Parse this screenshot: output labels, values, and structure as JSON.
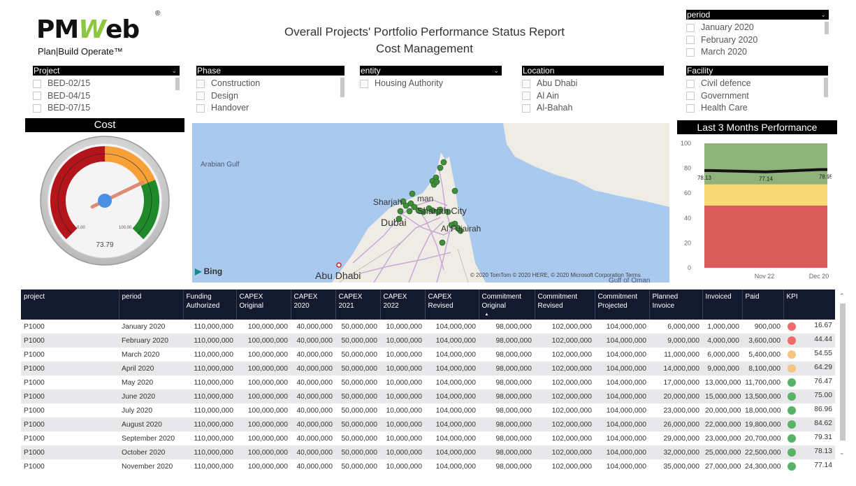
{
  "logo": {
    "main": "PMWeb",
    "p1": "PM",
    "w": "W",
    "rest": "eb",
    "reg": "®",
    "tagline": "Plan|Build Operate™"
  },
  "title": {
    "line1": "Overall Projects' Portfolio Performance Status Report",
    "line2": "Cost Management"
  },
  "slicers": {
    "period": {
      "label": "period",
      "items": [
        "January 2020",
        "February 2020",
        "March 2020"
      ]
    },
    "project": {
      "label": "Project",
      "items": [
        "BED-02/15",
        "BED-04/15",
        "BED-07/15"
      ]
    },
    "phase": {
      "label": "Phase",
      "items": [
        "Construction",
        "Design",
        "Handover"
      ]
    },
    "entity": {
      "label": "entity",
      "items": [
        "Housing Authority"
      ]
    },
    "location": {
      "label": "Location",
      "items": [
        "Abu Dhabi",
        "Al Ain",
        "Al-Bahah"
      ]
    },
    "facility": {
      "label": "Facility",
      "items": [
        "Civil defence",
        "Government",
        "Health Care"
      ]
    }
  },
  "cost": {
    "title": "Cost",
    "value": "73.79",
    "min_label": "0.00",
    "max_label": "100.00",
    "value_num": 73.79
  },
  "map": {
    "labels": {
      "gulf": "Arabian Gulf",
      "sharjah": "Sharjah",
      "ajman": "man",
      "dubai": "Dubai",
      "sharjahcity": "Sharjah City",
      "fujairah": "Al Fujairah",
      "abudhabi": "Abu Dhabi",
      "gulfoman": "Gulf of Oman"
    },
    "bing": "Bing",
    "copyright": "© 2020 TomTom © 2020 HERE, © 2020 Microsoft Corporation  Terms"
  },
  "perf": {
    "title": "Last 3 Months Performance",
    "y_ticks": [
      "100",
      "80",
      "60",
      "40",
      "20",
      "0"
    ],
    "x_ticks": [
      "Nov 22",
      "Dec 20"
    ],
    "point_labels": [
      "78.13",
      "77.14",
      "78.95"
    ]
  },
  "chart_data": {
    "type": "line",
    "title": "Last 3 Months Performance",
    "x": [
      "",
      "Nov 22",
      "Dec 20"
    ],
    "series": [
      {
        "values": [
          78.13,
          77.14,
          78.95
        ]
      }
    ],
    "bands": [
      {
        "from": 0,
        "to": 50,
        "color": "#d95b5b"
      },
      {
        "from": 50,
        "to": 67,
        "color": "#f8d872"
      },
      {
        "from": 67,
        "to": 100,
        "color": "#8fb27b"
      }
    ],
    "ylim": [
      0,
      100
    ],
    "xlabel": "",
    "ylabel": ""
  },
  "colors": {
    "red": "#ee6c6c",
    "orange": "#f5c483",
    "green": "#5ab267"
  },
  "table": {
    "headers": [
      "project",
      "period",
      "Funding Authorized",
      "CAPEX Original",
      "CAPEX 2020",
      "CAPEX 2021",
      "CAPEX 2022",
      "CAPEX Revised",
      "Commitment Original",
      "Commitment Revised",
      "Commitment Projected",
      "Planned Invoice",
      "Invoiced",
      "Paid",
      "KPI"
    ],
    "rows": [
      {
        "project": "P1000",
        "period": "January 2020",
        "funding": "110,000,000",
        "capex_orig": "100,000,000",
        "c2020": "40,000,000",
        "c2021": "50,000,000",
        "c2022": "10,000,000",
        "capex_rev": "104,000,000",
        "com_orig": "98,000,000",
        "com_rev": "102,000,000",
        "com_proj": "104,000,000",
        "planned": "6,000,000",
        "invoiced": "1,000,000",
        "paid": "900,000",
        "kpi_color": "red",
        "kpi": "16.67"
      },
      {
        "project": "P1000",
        "period": "February 2020",
        "funding": "110,000,000",
        "capex_orig": "100,000,000",
        "c2020": "40,000,000",
        "c2021": "50,000,000",
        "c2022": "10,000,000",
        "capex_rev": "104,000,000",
        "com_orig": "98,000,000",
        "com_rev": "102,000,000",
        "com_proj": "104,000,000",
        "planned": "9,000,000",
        "invoiced": "4,000,000",
        "paid": "3,600,000",
        "kpi_color": "red",
        "kpi": "44.44"
      },
      {
        "project": "P1000",
        "period": "March 2020",
        "funding": "110,000,000",
        "capex_orig": "100,000,000",
        "c2020": "40,000,000",
        "c2021": "50,000,000",
        "c2022": "10,000,000",
        "capex_rev": "104,000,000",
        "com_orig": "98,000,000",
        "com_rev": "102,000,000",
        "com_proj": "104,000,000",
        "planned": "11,000,000",
        "invoiced": "6,000,000",
        "paid": "5,400,000",
        "kpi_color": "orange",
        "kpi": "54.55"
      },
      {
        "project": "P1000",
        "period": "April 2020",
        "funding": "110,000,000",
        "capex_orig": "100,000,000",
        "c2020": "40,000,000",
        "c2021": "50,000,000",
        "c2022": "10,000,000",
        "capex_rev": "104,000,000",
        "com_orig": "98,000,000",
        "com_rev": "102,000,000",
        "com_proj": "104,000,000",
        "planned": "14,000,000",
        "invoiced": "9,000,000",
        "paid": "8,100,000",
        "kpi_color": "orange",
        "kpi": "64.29"
      },
      {
        "project": "P1000",
        "period": "May 2020",
        "funding": "110,000,000",
        "capex_orig": "100,000,000",
        "c2020": "40,000,000",
        "c2021": "50,000,000",
        "c2022": "10,000,000",
        "capex_rev": "104,000,000",
        "com_orig": "98,000,000",
        "com_rev": "102,000,000",
        "com_proj": "104,000,000",
        "planned": "17,000,000",
        "invoiced": "13,000,000",
        "paid": "11,700,000",
        "kpi_color": "green",
        "kpi": "76.47"
      },
      {
        "project": "P1000",
        "period": "June 2020",
        "funding": "110,000,000",
        "capex_orig": "100,000,000",
        "c2020": "40,000,000",
        "c2021": "50,000,000",
        "c2022": "10,000,000",
        "capex_rev": "104,000,000",
        "com_orig": "98,000,000",
        "com_rev": "102,000,000",
        "com_proj": "104,000,000",
        "planned": "20,000,000",
        "invoiced": "15,000,000",
        "paid": "13,500,000",
        "kpi_color": "green",
        "kpi": "75.00"
      },
      {
        "project": "P1000",
        "period": "July 2020",
        "funding": "110,000,000",
        "capex_orig": "100,000,000",
        "c2020": "40,000,000",
        "c2021": "50,000,000",
        "c2022": "10,000,000",
        "capex_rev": "104,000,000",
        "com_orig": "98,000,000",
        "com_rev": "102,000,000",
        "com_proj": "104,000,000",
        "planned": "23,000,000",
        "invoiced": "20,000,000",
        "paid": "18,000,000",
        "kpi_color": "green",
        "kpi": "86.96"
      },
      {
        "project": "P1000",
        "period": "August 2020",
        "funding": "110,000,000",
        "capex_orig": "100,000,000",
        "c2020": "40,000,000",
        "c2021": "50,000,000",
        "c2022": "10,000,000",
        "capex_rev": "104,000,000",
        "com_orig": "98,000,000",
        "com_rev": "102,000,000",
        "com_proj": "104,000,000",
        "planned": "26,000,000",
        "invoiced": "22,000,000",
        "paid": "19,800,000",
        "kpi_color": "green",
        "kpi": "84.62"
      },
      {
        "project": "P1000",
        "period": "September 2020",
        "funding": "110,000,000",
        "capex_orig": "100,000,000",
        "c2020": "40,000,000",
        "c2021": "50,000,000",
        "c2022": "10,000,000",
        "capex_rev": "104,000,000",
        "com_orig": "98,000,000",
        "com_rev": "102,000,000",
        "com_proj": "104,000,000",
        "planned": "29,000,000",
        "invoiced": "23,000,000",
        "paid": "20,700,000",
        "kpi_color": "green",
        "kpi": "79.31"
      },
      {
        "project": "P1000",
        "period": "October 2020",
        "funding": "110,000,000",
        "capex_orig": "100,000,000",
        "c2020": "40,000,000",
        "c2021": "50,000,000",
        "c2022": "10,000,000",
        "capex_rev": "104,000,000",
        "com_orig": "98,000,000",
        "com_rev": "102,000,000",
        "com_proj": "104,000,000",
        "planned": "32,000,000",
        "invoiced": "25,000,000",
        "paid": "22,500,000",
        "kpi_color": "green",
        "kpi": "78.13"
      },
      {
        "project": "P1000",
        "period": "November 2020",
        "funding": "110,000,000",
        "capex_orig": "100,000,000",
        "c2020": "40,000,000",
        "c2021": "50,000,000",
        "c2022": "10,000,000",
        "capex_rev": "104,000,000",
        "com_orig": "98,000,000",
        "com_rev": "102,000,000",
        "com_proj": "104,000,000",
        "planned": "35,000,000",
        "invoiced": "27,000,000",
        "paid": "24,300,000",
        "kpi_color": "green",
        "kpi": "77.14"
      }
    ]
  }
}
